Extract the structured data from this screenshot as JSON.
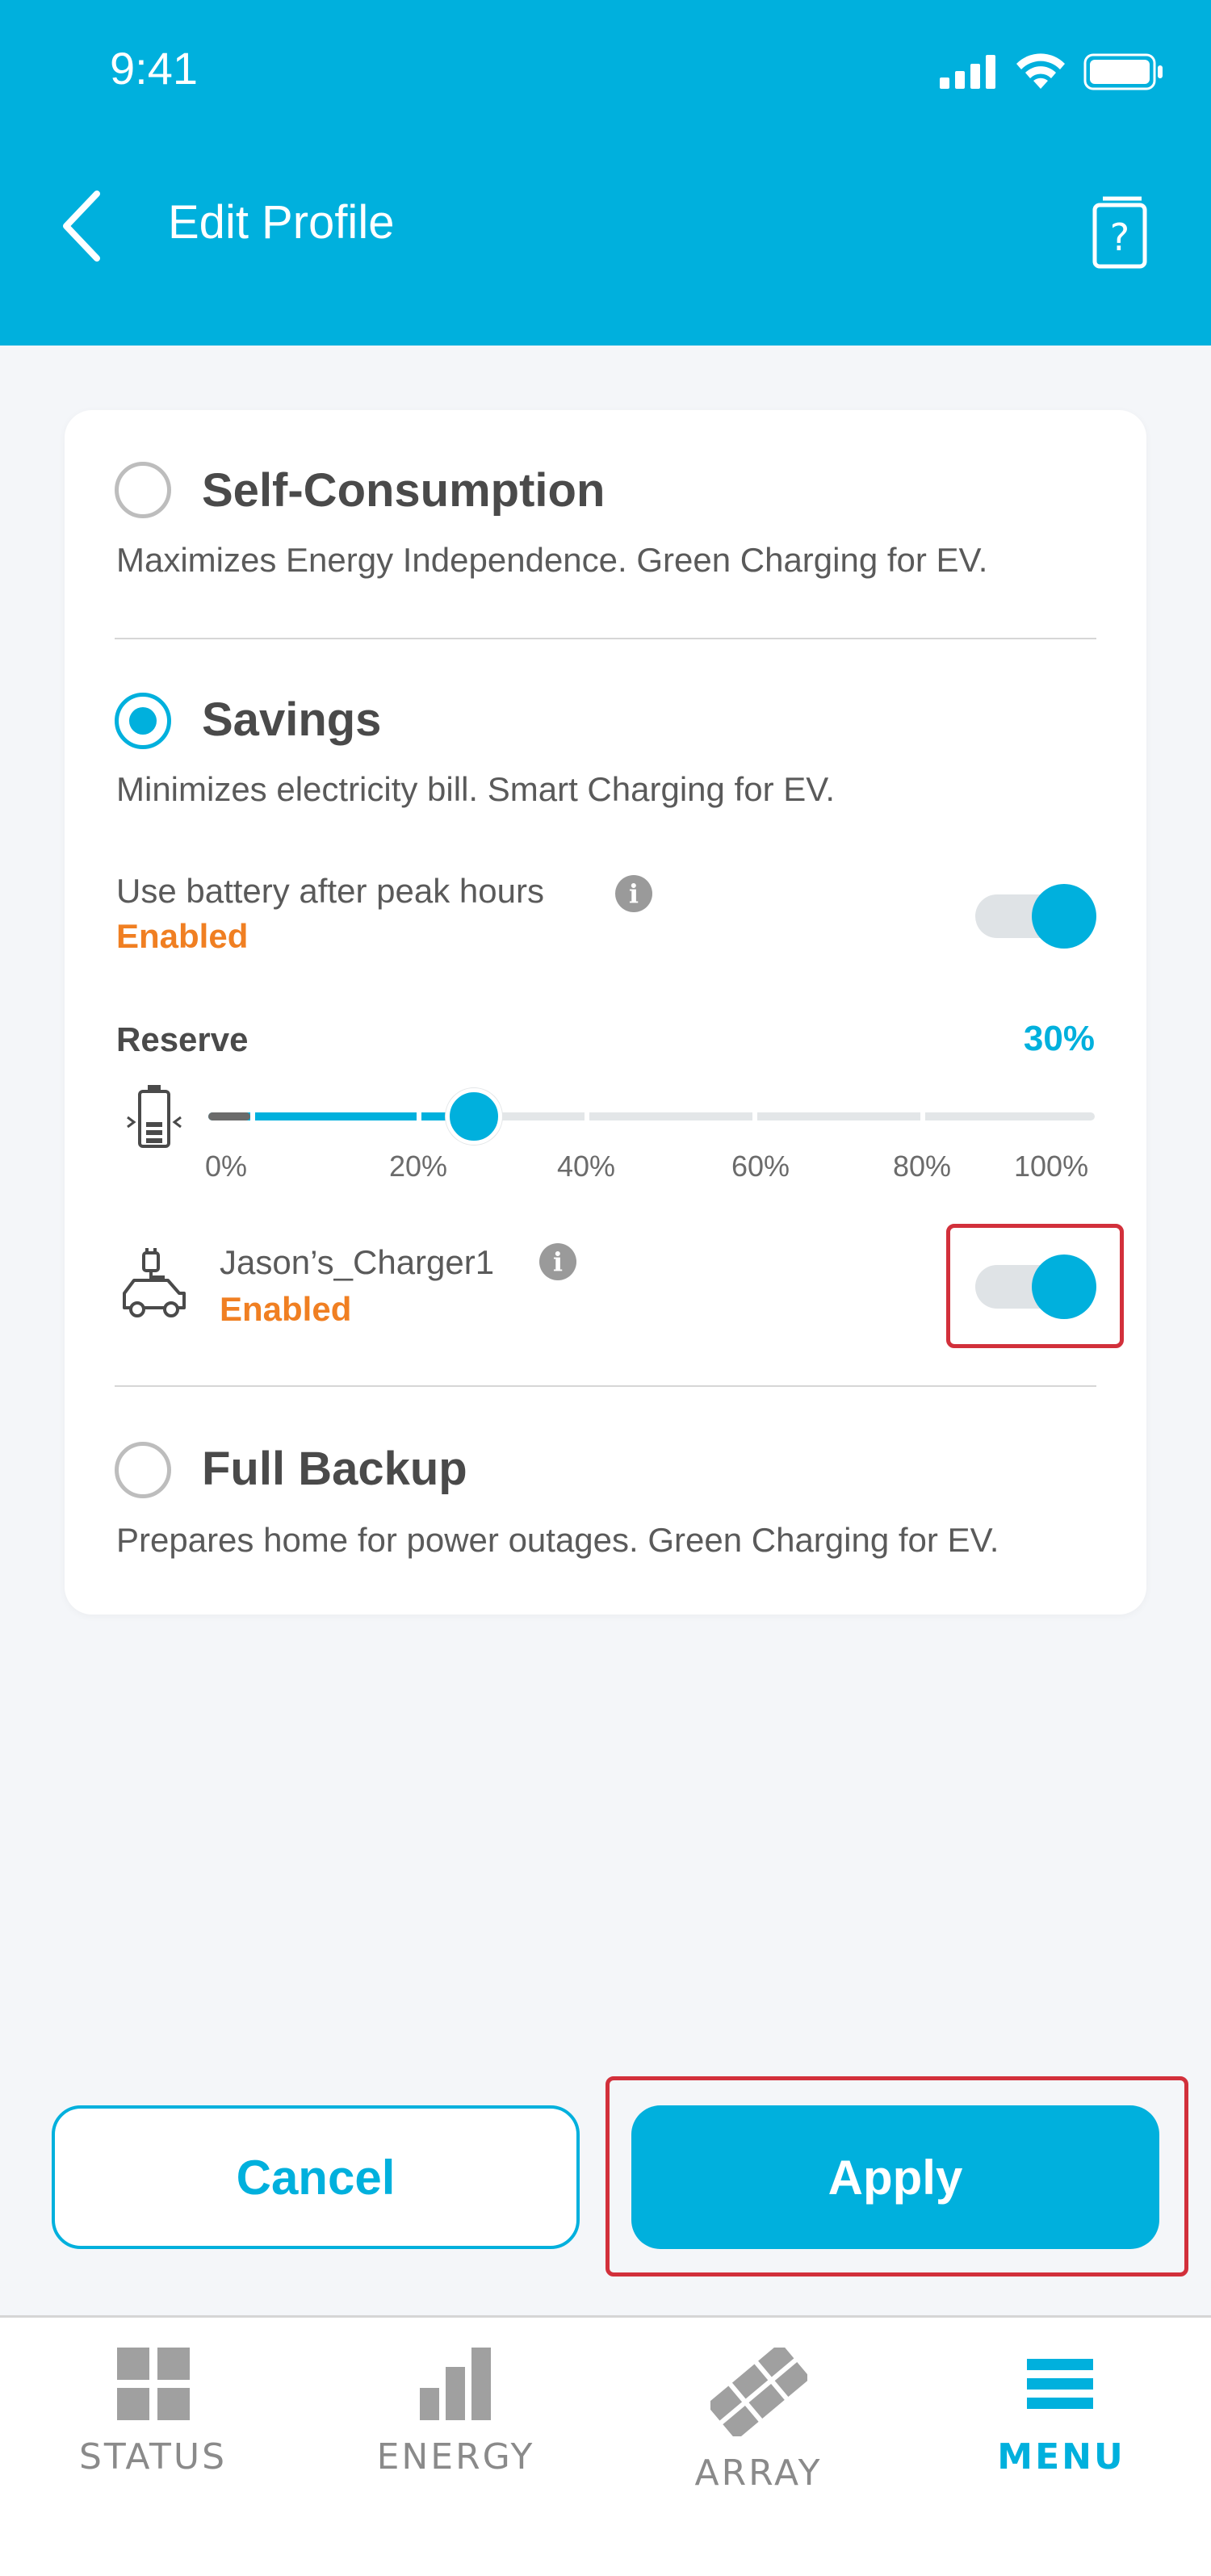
{
  "status_bar": {
    "time": "9:41"
  },
  "header": {
    "title": "Edit Profile"
  },
  "options": {
    "self_consumption": {
      "title": "Self-Consumption",
      "description": "Maximizes Energy Independence. Green Charging for EV.",
      "selected": false
    },
    "savings": {
      "title": "Savings",
      "description": "Minimizes electricity bill. Smart Charging for EV.",
      "selected": true,
      "battery_after_peak": {
        "label": "Use battery after peak hours",
        "status": "Enabled",
        "on": true
      },
      "reserve": {
        "label": "Reserve",
        "value_text": "30%",
        "value_percent": 30,
        "ticks": [
          "0%",
          "20%",
          "40%",
          "60%",
          "80%",
          "100%"
        ]
      },
      "charger": {
        "name": "Jason’s_Charger1",
        "status": "Enabled",
        "on": true
      }
    },
    "full_backup": {
      "title": "Full Backup",
      "description": "Prepares home for power outages. Green Charging for EV.",
      "selected": false
    }
  },
  "buttons": {
    "cancel": "Cancel",
    "apply": "Apply"
  },
  "tabs": [
    {
      "label": "STATUS",
      "icon": "status-grid-icon",
      "active": false
    },
    {
      "label": "ENERGY",
      "icon": "energy-bars-icon",
      "active": false
    },
    {
      "label": "ARRAY",
      "icon": "solar-array-icon",
      "active": false
    },
    {
      "label": "MENU",
      "icon": "menu-icon",
      "active": true
    }
  ],
  "colors": {
    "accent": "#00b0dd",
    "enabled": "#f07f22",
    "highlight": "#d2303b"
  }
}
